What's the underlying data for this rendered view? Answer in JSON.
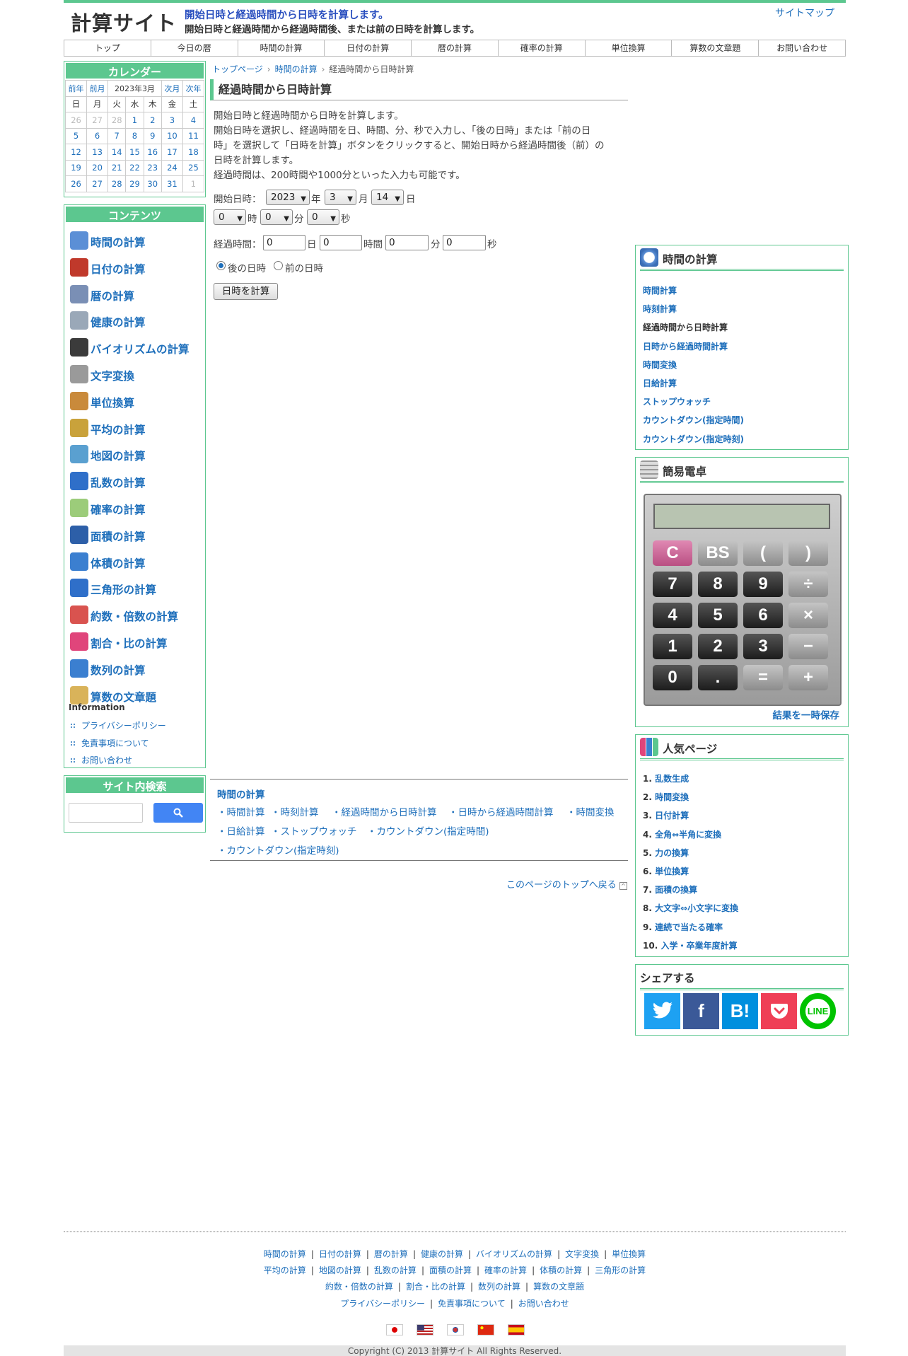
{
  "header": {
    "logo": "計算サイト",
    "tagline": "開始日時と経過時間から日時を計算します。",
    "subline": "開始日時と経過時間から経過時間後、または前の日時を計算します。",
    "sitemap": "サイトマップ"
  },
  "gnav": [
    "トップ",
    "今日の暦",
    "時間の計算",
    "日付の計算",
    "暦の計算",
    "確率の計算",
    "単位換算",
    "算数の文章題",
    "お問い合わせ"
  ],
  "calendar": {
    "heading": "カレンダー",
    "prev_year": "前年",
    "prev_month": "前月",
    "current": "2023年3月",
    "next_month": "次月",
    "next_year": "次年",
    "weekdays": [
      "日",
      "月",
      "火",
      "水",
      "木",
      "金",
      "土"
    ],
    "weeks": [
      [
        "26",
        "27",
        "28",
        "1",
        "2",
        "3",
        "4"
      ],
      [
        "5",
        "6",
        "7",
        "8",
        "9",
        "10",
        "11"
      ],
      [
        "12",
        "13",
        "14",
        "15",
        "16",
        "17",
        "18"
      ],
      [
        "19",
        "20",
        "21",
        "22",
        "23",
        "24",
        "25"
      ],
      [
        "26",
        "27",
        "28",
        "29",
        "30",
        "31",
        "1"
      ]
    ]
  },
  "contents": {
    "heading": "コンテンツ",
    "items": [
      {
        "label": "時間の計算",
        "icon": "clock-icon",
        "color": "#5b8fd6"
      },
      {
        "label": "日付の計算",
        "icon": "calendar-10-icon",
        "color": "#c0392b"
      },
      {
        "label": "暦の計算",
        "icon": "calendar-grid-icon",
        "color": "#7a8fb5"
      },
      {
        "label": "健康の計算",
        "icon": "syringe-icon",
        "color": "#9aa8b8"
      },
      {
        "label": "バイオリズムの計算",
        "icon": "monitor-wave-icon",
        "color": "#3b3b3b"
      },
      {
        "label": "文字変換",
        "icon": "letter-a-icon",
        "color": "#9a9a9a"
      },
      {
        "label": "単位換算",
        "icon": "ruler-icon",
        "color": "#c98a3b"
      },
      {
        "label": "平均の計算",
        "icon": "balance-scale-icon",
        "color": "#c9a23b"
      },
      {
        "label": "地図の計算",
        "icon": "map-icon",
        "color": "#5aa0d0"
      },
      {
        "label": "乱数の計算",
        "icon": "refresh-arrows-icon",
        "color": "#2f6fc9"
      },
      {
        "label": "確率の計算",
        "icon": "dice-icon",
        "color": "#9ccc7a"
      },
      {
        "label": "面積の計算",
        "icon": "square-icon",
        "color": "#2d5fa8"
      },
      {
        "label": "体積の計算",
        "icon": "cube-icon",
        "color": "#3b7fd0"
      },
      {
        "label": "三角形の計算",
        "icon": "triangle-icon",
        "color": "#2f6fc9"
      },
      {
        "label": "約数・倍数の計算",
        "icon": "cross-circle-icon",
        "color": "#d9534f"
      },
      {
        "label": "割合・比の計算",
        "icon": "pie-chart-icon",
        "color": "#e0457b"
      },
      {
        "label": "数列の計算",
        "icon": "bar-chart-icon",
        "color": "#3b7fd0"
      },
      {
        "label": "算数の文章題",
        "icon": "notepad-icon",
        "color": "#d9b35a"
      }
    ],
    "info_heading": "Information",
    "info_links": [
      "プライバシーポリシー",
      "免責事項について",
      "お問い合わせ"
    ]
  },
  "search": {
    "heading": "サイト内検索",
    "button_icon": "search-icon"
  },
  "breadcrumb": [
    "トップページ",
    "時間の計算",
    "経過時間から日時計算"
  ],
  "main": {
    "title": "経過時間から日時計算",
    "desc": [
      "開始日時と経過時間から日時を計算します。",
      "開始日時を選択し、経過時間を日、時間、分、秒で入力し、「後の日時」または「前の日",
      "時」を選択して「日時を計算」ボタンをクリックすると、開始日時から経過時間後（前）の",
      "日時を計算します。",
      "経過時間は、200時間や1000分といった入力も可能です。"
    ],
    "start_label": "開始日時：",
    "year": "2023",
    "year_unit": "年",
    "month": "3",
    "month_unit": "月",
    "day": "14",
    "day_unit": "日",
    "hour": "0",
    "hour_unit": "時",
    "minute": "0",
    "minute_unit": "分",
    "second": "0",
    "second_unit": "秒",
    "elapsed_label": "経過時間：",
    "e_day": "0",
    "e_day_unit": "日",
    "e_hour": "0",
    "e_hour_unit": "時間",
    "e_min": "0",
    "e_min_unit": "分",
    "e_sec": "0",
    "e_sec_unit": "秒",
    "radio_after": "後の日時",
    "radio_before": "前の日時",
    "selected_direction": "after",
    "calc_button": "日時を計算"
  },
  "related": {
    "heading": "時間の計算",
    "row1": [
      "・時間計算",
      "・時刻計算",
      "・経過時間から日時計算",
      "・日時から経過時間計算",
      "・時間変換"
    ],
    "row2": [
      "・日給計算",
      "・ストップウォッチ",
      "・カウントダウン(指定時間)"
    ],
    "row3": [
      "・カウントダウン(指定時刻)"
    ]
  },
  "totop": "このページのトップへ戻る",
  "right_time": {
    "heading": "時間の計算",
    "links": [
      "時間計算",
      "時刻計算",
      "経過時間から日時計算",
      "日時から経過時間計算",
      "時間変換",
      "日給計算",
      "ストップウォッチ",
      "カウントダウン(指定時間)",
      "カウントダウン(指定時刻)"
    ],
    "current_index": 2
  },
  "calculator": {
    "heading": "簡易電卓",
    "keys": [
      [
        "C",
        "BS",
        "(",
        ")"
      ],
      [
        "7",
        "8",
        "9",
        "÷"
      ],
      [
        "4",
        "5",
        "6",
        "×"
      ],
      [
        "1",
        "2",
        "3",
        "−"
      ],
      [
        "0",
        ".",
        "=",
        "+"
      ]
    ],
    "save": "結果を一時保存"
  },
  "popular": {
    "heading": "人気ページ",
    "items": [
      {
        "n": "1.",
        "label": "乱数生成"
      },
      {
        "n": "2.",
        "label": "時間変換"
      },
      {
        "n": "3.",
        "label": "日付計算"
      },
      {
        "n": "4.",
        "label": "全角⇔半角に変換"
      },
      {
        "n": "5.",
        "label": "力の換算"
      },
      {
        "n": "6.",
        "label": "単位換算"
      },
      {
        "n": "7.",
        "label": "面積の換算"
      },
      {
        "n": "8.",
        "label": "大文字⇔小文字に変換"
      },
      {
        "n": "9.",
        "label": "連続で当たる確率"
      },
      {
        "n": "10.",
        "label": "入学・卒業年度計算"
      }
    ]
  },
  "share": {
    "heading": "シェアする",
    "buttons": [
      {
        "label": "",
        "icon": "twitter-icon",
        "color": "#1da1f2"
      },
      {
        "label": "f",
        "icon": "facebook-icon",
        "color": "#3b5998"
      },
      {
        "label": "B!",
        "icon": "hatena-bookmark-icon",
        "color": "#008fde"
      },
      {
        "label": "",
        "icon": "pocket-icon",
        "color": "#ef3f56"
      },
      {
        "label": "LINE",
        "icon": "line-icon",
        "color": "#00c300"
      }
    ]
  },
  "footer": {
    "row1": [
      "時間の計算",
      "日付の計算",
      "暦の計算",
      "健康の計算",
      "バイオリズムの計算",
      "文字変換",
      "単位換算"
    ],
    "row2": [
      "平均の計算",
      "地図の計算",
      "乱数の計算",
      "面積の計算",
      "確率の計算",
      "体積の計算",
      "三角形の計算"
    ],
    "row3": [
      "約数・倍数の計算",
      "割合・比の計算",
      "数列の計算",
      "算数の文章題"
    ],
    "row4": [
      "プライバシーポリシー",
      "免責事項について",
      "お問い合わせ"
    ],
    "flags": [
      "japan-flag-icon",
      "usa-flag-icon",
      "korea-flag-icon",
      "china-flag-icon",
      "spain-flag-icon"
    ],
    "copyright": "Copyright (C) 2013 計算サイト All Rights Reserved."
  }
}
